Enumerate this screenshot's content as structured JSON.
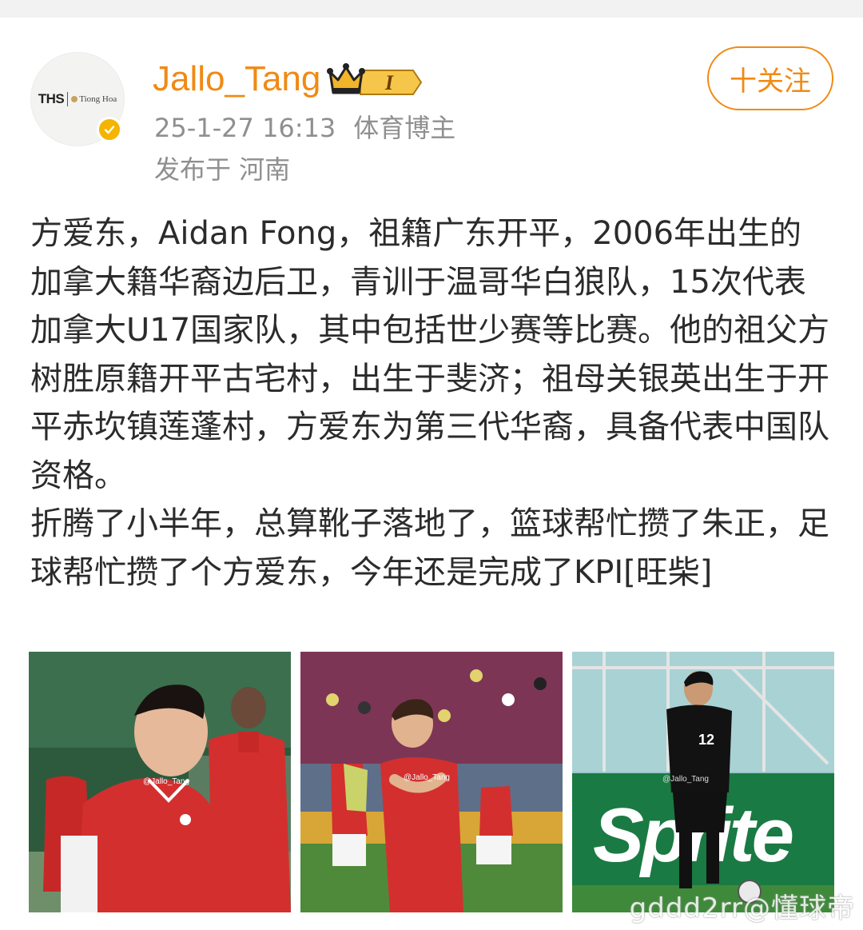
{
  "header": {
    "avatar_logo_text": "THS",
    "avatar_logo_brand": "Tiong Hoa",
    "username": "Jallo_Tang",
    "vip_level": "I",
    "timestamp": "25-1-27 16:13",
    "category": "体育博主",
    "location": "发布于 河南",
    "follow_label": "十关注"
  },
  "post": {
    "paragraphs": [
      "方爱东，Aidan Fong，祖籍广东开平，2006年出生的加拿大籍华裔边后卫，青训于温哥华白狼队，15次代表加拿大U17国家队，其中包括世少赛等比赛。他的祖父方树胜原籍开平古宅村，出生于斐济；祖母关银英出生于开平赤坎镇莲蓬村，方爱东为第三代华裔，具备代表中国队资格。",
      "折腾了小半年，总算靴子落地了，篮球帮忙攒了朱正，足球帮忙攒了个方爱东，今年还是完成了KPI[旺柴]"
    ]
  },
  "photos": {
    "photo1_caption": "@Jallo_Tang",
    "photo2_caption": "@Jallo_Tang",
    "photo3_caption": "@Jallo_Tang",
    "jersey_number": "12",
    "banner_text": "Sprite"
  },
  "watermark": "gddd2rr@懂球帝",
  "colors": {
    "accent": "#f08a14",
    "verified": "#f5b400",
    "meta_text": "#8f8f8f"
  }
}
